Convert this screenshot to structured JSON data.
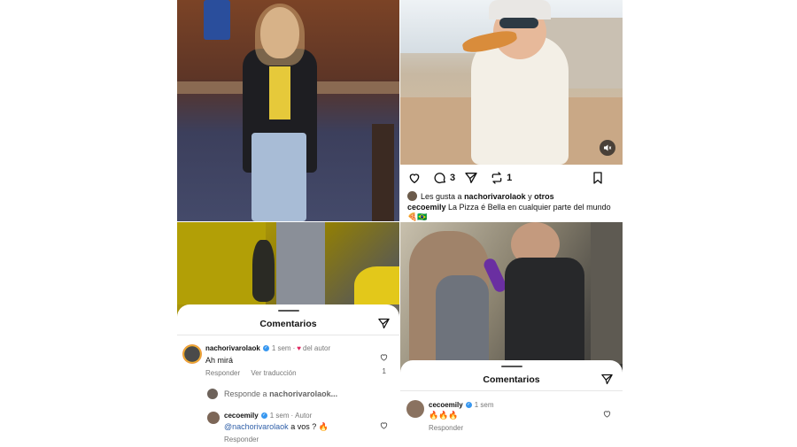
{
  "post": {
    "counts": {
      "comments": "3",
      "reposts": "1"
    },
    "likes_prefix": "Les gusta a",
    "likes_user": "nachorivarolaok",
    "likes_suffix": "y",
    "likes_others": "otros",
    "caption_user": "cecoemily",
    "caption_text": "La Pizza é Bella en cualquier parte del mundo",
    "caption_emojis": "🍕🇧🇷"
  },
  "comments_left": {
    "title": "Comentarios",
    "comment1": {
      "user": "nachorivarolaok",
      "time": "1 sem",
      "liked_by": "del autor",
      "text": "Ah mirá",
      "reply_label": "Responder",
      "translate_label": "Ver traducción",
      "like_count": "1"
    },
    "reply_placeholder_prefix": "Responde a",
    "reply_placeholder_user": "nachorivarolaok...",
    "comment2": {
      "user": "cecoemily",
      "time": "1 sem",
      "author_tag": "Autor",
      "mention": "@nachorivarolaok",
      "text": "a vos ? 🔥",
      "reply_label": "Responder"
    }
  },
  "comments_right": {
    "title": "Comentarios",
    "comment1": {
      "user": "cecoemily",
      "time": "1 sem",
      "text": "🔥🔥🔥",
      "reply_label": "Responder"
    }
  },
  "icons": [
    "heart-icon",
    "comment-icon",
    "share-icon",
    "repost-icon",
    "bookmark-icon",
    "mute-icon",
    "send-icon",
    "verified-icon"
  ],
  "colors": {
    "verified": "#3797f0",
    "like_red": "#e0245e",
    "mention": "#2f5fa8"
  }
}
